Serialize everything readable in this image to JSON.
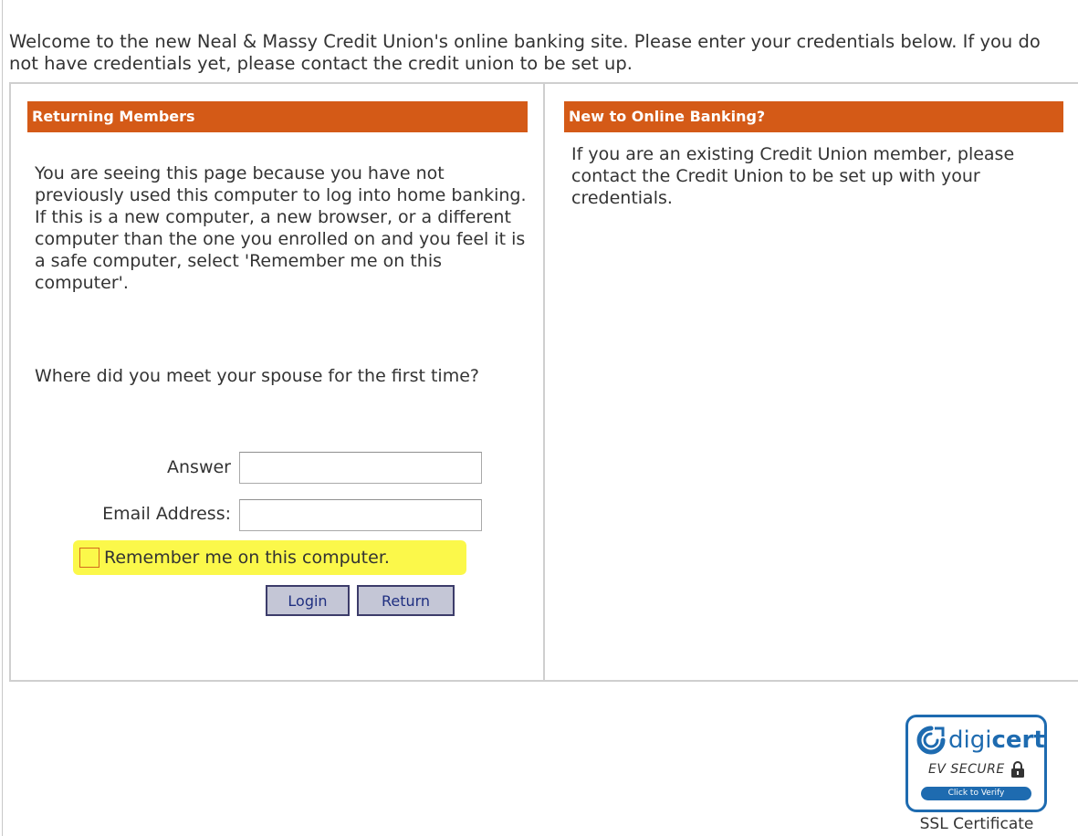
{
  "welcome": {
    "text": "Welcome to the new Neal & Massy Credit Union's online banking site. Please enter your credentials below. If you do not have credentials yet, please contact the credit union to be set up."
  },
  "returning": {
    "header": "Returning Members",
    "intro": "You are seeing this page because you have not previously used this computer to log into home banking. If this is a new computer, a new browser, or a different computer than the one you enrolled on and you feel it is a safe computer, select 'Remember me on this computer'.",
    "question": "Where did you meet your spouse for the first time?",
    "answer_label": "Answer",
    "answer_value": "",
    "email_label": "Email Address:",
    "email_value": "",
    "remember_label": "Remember me on this computer.",
    "remember_checked": false,
    "login_label": "Login",
    "return_label": "Return"
  },
  "new_banking": {
    "header": "New to Online Banking?",
    "text": "If you are an existing Credit Union member, please contact the Credit Union to be set up with your credentials."
  },
  "certificate": {
    "brand_part1": "digi",
    "brand_part2": "cert",
    "ev_text": "EV SECURE",
    "verify_label": "Click to Verify",
    "caption": "SSL Certificate"
  },
  "colors": {
    "header_bg": "#d45a17",
    "highlight": "#fbf84a",
    "button_bg": "#c4c6d6",
    "button_text": "#1f2f80",
    "digicert_blue": "#1e6bb0"
  },
  "icons": {
    "lock": "lock-icon",
    "digicert_logo": "digicert-logo-icon"
  }
}
